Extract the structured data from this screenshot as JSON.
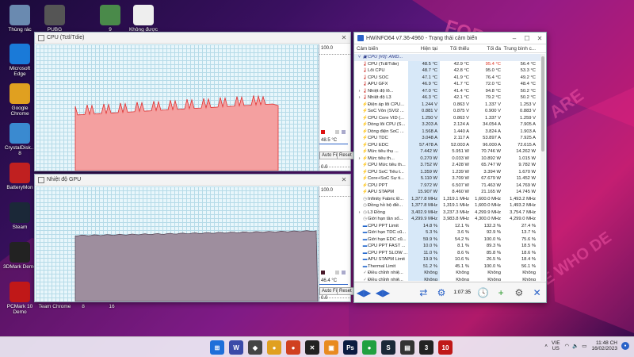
{
  "desktop": {
    "icons": [
      {
        "label": "Thùng rác",
        "icon": "recycle-bin-icon",
        "color": "#6a8ab0"
      },
      {
        "label": "PUBG BATTLEGR...",
        "icon": "pubg-icon",
        "color": "#555"
      },
      {
        "label": "Không được",
        "icon": "file-icon",
        "color": "#eeeeee"
      },
      {
        "label": "9",
        "icon": "image-icon",
        "color": "#4a8a4a"
      },
      {
        "label": "Microsoft Edge",
        "icon": "edge-icon",
        "color": "#1a7ad8"
      },
      {
        "label": "Google Chrome",
        "icon": "chrome-icon",
        "color": "#e0a020"
      },
      {
        "label": "CrystalDisk... 8",
        "icon": "crystaldisk-icon",
        "color": "#3a8ad0"
      },
      {
        "label": "BatteryMon",
        "icon": "battery-icon",
        "color": "#c02020"
      },
      {
        "label": "Steam",
        "icon": "steam-icon",
        "color": "#1b2838"
      },
      {
        "label": "3DMark Demo",
        "icon": "3dmark-icon",
        "color": "#222"
      },
      {
        "label": "PCMark 10 Demo",
        "icon": "pcmark-icon",
        "color": "#c01818"
      },
      {
        "label": "Team Chrome",
        "icon": "chrome-icon",
        "color": "#e0a020"
      },
      {
        "label": "8",
        "icon": "image-icon",
        "color": "#333"
      },
      {
        "label": "16",
        "icon": "image-icon",
        "color": "#333"
      }
    ]
  },
  "cpu_window": {
    "title": "CPU (Tctl/Tdie)",
    "max_label": "100.0",
    "min_label": "0.0",
    "current": "48.5 °C",
    "auto_fit": "Auto Fit",
    "reset": "Reset",
    "fill_color": "#f4a0a0",
    "line_color": "#e03030"
  },
  "gpu_window": {
    "title": "Nhiệt độ GPU",
    "max_label": "100.0",
    "min_label": "0.0",
    "current": "46.4 °C",
    "auto_fit": "Auto Fit",
    "reset": "Reset",
    "fill_color": "#9e8e9e",
    "line_color": "#5a4a5a"
  },
  "hwinfo": {
    "title": "HWiNFO64 v7.36-4960 - Trạng thái cảm biến",
    "columns": {
      "name": "Cảm biến",
      "current": "Hiện tại",
      "min": "Tối thiểu",
      "max": "Tối đa",
      "avg": "Trung bình c..."
    },
    "rows": [
      {
        "type": "group",
        "name": "CPU [#0]: AMD...",
        "icon": "chip-icon",
        "current": "",
        "min": "",
        "max": "",
        "avg": ""
      },
      {
        "name": "CPU (Tctl/Tdie)",
        "icon": "thermometer-icon",
        "ic": "t-red",
        "current": "48.5 °C",
        "min": "42.9 °C",
        "max": "95.4 °C",
        "avg": "56.4 °C",
        "maxred": true
      },
      {
        "name": "Lõi CPU",
        "icon": "thermometer-icon",
        "ic": "t-red",
        "current": "48.7 °C",
        "min": "42.8 °C",
        "max": "95.0 °C",
        "avg": "53.3 °C"
      },
      {
        "name": "CPU SOC",
        "icon": "thermometer-icon",
        "ic": "t-red",
        "current": "47.1 °C",
        "min": "41.9 °C",
        "max": "76.4 °C",
        "avg": "49.2 °C"
      },
      {
        "name": "APU GFX",
        "icon": "thermometer-icon",
        "ic": "t-red",
        "current": "46.9 °C",
        "min": "41.7 °C",
        "max": "72.0 °C",
        "avg": "48.4 °C"
      },
      {
        "name": "Nhiệt độ lõ...",
        "icon": "thermometer-icon",
        "ic": "t-red",
        "current": "47.0 °C",
        "min": "41.4 °C",
        "max": "94.8 °C",
        "avg": "50.2 °C",
        "expand": true
      },
      {
        "name": "Nhiệt độ L3",
        "icon": "thermometer-icon",
        "ic": "t-red",
        "current": "46.3 °C",
        "min": "42.1 °C",
        "max": "79.2 °C",
        "avg": "50.2 °C",
        "expand": true
      },
      {
        "name": "Điện áp lõi CPU...",
        "icon": "voltage-icon",
        "ic": "t-orange",
        "current": "1.244 V",
        "min": "0.863 V",
        "max": "1.337 V",
        "avg": "1.253 V"
      },
      {
        "name": "SoC Vôn (SVI2 ...",
        "icon": "voltage-icon",
        "ic": "t-orange",
        "current": "0.881 V",
        "min": "0.875 V",
        "max": "0.900 V",
        "avg": "0.883 V"
      },
      {
        "name": "CPU Core VID (...",
        "icon": "voltage-icon",
        "ic": "t-orange",
        "current": "1.250 V",
        "min": "0.863 V",
        "max": "1.337 V",
        "avg": "1.259 V"
      },
      {
        "name": "Dòng lõi CPU (S...",
        "icon": "current-icon",
        "ic": "t-orange",
        "current": "3.203 A",
        "min": "2.124 A",
        "max": "34.054 A",
        "avg": "7.905 A"
      },
      {
        "name": "Dòng điện SoC ...",
        "icon": "current-icon",
        "ic": "t-orange",
        "current": "1.568 A",
        "min": "1.440 A",
        "max": "3.824 A",
        "avg": "1.903 A"
      },
      {
        "name": "CPU TDC",
        "icon": "current-icon",
        "ic": "t-orange",
        "current": "3.048 A",
        "min": "2.117 A",
        "max": "53.897 A",
        "avg": "7.925 A"
      },
      {
        "name": "CPU EDC",
        "icon": "current-icon",
        "ic": "t-orange",
        "current": "57.478 A",
        "min": "52.003 A",
        "max": "96.000 A",
        "avg": "72.615 A"
      },
      {
        "name": "Mức tiêu thụ ...",
        "icon": "power-icon",
        "ic": "t-orange",
        "current": "7.442 W",
        "min": "5.951 W",
        "max": "70.746 W",
        "avg": "14.262 W"
      },
      {
        "name": "Mức tiêu th...",
        "icon": "power-icon",
        "ic": "t-orange",
        "current": "0.270 W",
        "min": "0.033 W",
        "max": "10.892 W",
        "avg": "1.015 W",
        "expand": true
      },
      {
        "name": "CPU Mức tiêu th...",
        "icon": "power-icon",
        "ic": "t-orange",
        "current": "3.752 W",
        "min": "2.428 W",
        "max": "65.747 W",
        "avg": "9.782 W"
      },
      {
        "name": "CPU SoC Tiêu t...",
        "icon": "power-icon",
        "ic": "t-orange",
        "current": "1.359 W",
        "min": "1.239 W",
        "max": "3.394 W",
        "avg": "1.670 W"
      },
      {
        "name": "Core+SoC Sự ti...",
        "icon": "power-icon",
        "ic": "t-orange",
        "current": "5.110 W",
        "min": "3.709 W",
        "max": "67.679 W",
        "avg": "11.452 W"
      },
      {
        "name": "CPU PPT",
        "icon": "power-icon",
        "ic": "t-orange",
        "current": "7.972 W",
        "min": "6.507 W",
        "max": "71.463 W",
        "avg": "14.769 W"
      },
      {
        "name": "APU STAPM",
        "icon": "power-icon",
        "ic": "t-orange",
        "current": "15.907 W",
        "min": "8.460 W",
        "max": "21.165 W",
        "avg": "14.745 W"
      },
      {
        "name": "Infinity Fabric Đ...",
        "icon": "clock-icon",
        "ic": "t-gray",
        "current": "1,377.8 MHz",
        "min": "1,319.1 MHz",
        "max": "1,600.0 MHz",
        "avg": "1,493.2 MHz"
      },
      {
        "name": "Đồng hồ bộ điề...",
        "icon": "clock-icon",
        "ic": "t-gray",
        "current": "1,377.8 MHz",
        "min": "1,319.1 MHz",
        "max": "1,600.0 MHz",
        "avg": "1,493.2 MHz"
      },
      {
        "name": "L3 Đồng",
        "icon": "clock-icon",
        "ic": "t-gray",
        "current": "3,402.9 MHz",
        "min": "3,237.3 MHz",
        "max": "4,299.9 MHz",
        "avg": "3,754.7 MHz",
        "expand": true
      },
      {
        "name": "Giới hạn tần số...",
        "icon": "clock-icon",
        "ic": "t-gray",
        "current": "4,299.9 MHz",
        "min": "3,983.8 MHz",
        "max": "4,300.0 MHz",
        "avg": "4,299.0 MHz"
      },
      {
        "name": "CPU PPT Limit",
        "icon": "percent-icon",
        "ic": "t-blue",
        "current": "14.8 %",
        "min": "12.1 %",
        "max": "132.3 %",
        "avg": "27.4 %"
      },
      {
        "name": "Giới hạn TDC cũ...",
        "icon": "percent-icon",
        "ic": "t-blue",
        "current": "5.3 %",
        "min": "3.6 %",
        "max": "92.9 %",
        "avg": "13.7 %"
      },
      {
        "name": "Giới hạn EDC cũ...",
        "icon": "percent-icon",
        "ic": "t-blue",
        "current": "59.9 %",
        "min": "54.2 %",
        "max": "100.0 %",
        "avg": "75.6 %"
      },
      {
        "name": "CPU PPT FAST ...",
        "icon": "percent-icon",
        "ic": "t-blue",
        "current": "10.0 %",
        "min": "8.1 %",
        "max": "89.3 %",
        "avg": "18.5 %"
      },
      {
        "name": "CPU PPT SLOW ...",
        "icon": "percent-icon",
        "ic": "t-blue",
        "current": "11.0 %",
        "min": "8.6 %",
        "max": "85.8 %",
        "avg": "18.6 %"
      },
      {
        "name": "APU STAPM Limit",
        "icon": "percent-icon",
        "ic": "t-blue",
        "current": "19.9 %",
        "min": "10.6 %",
        "max": "26.5 %",
        "avg": "18.4 %"
      },
      {
        "name": "Thermal Limit",
        "icon": "percent-icon",
        "ic": "t-blue",
        "current": "51.2 %",
        "min": "45.1 %",
        "max": "100.0 %",
        "avg": "56.1 %"
      },
      {
        "name": "Điều chỉnh nhiệ...",
        "icon": "check-icon",
        "ic": "t-gray",
        "current": "Không",
        "min": "Không",
        "max": "Không",
        "avg": "Không"
      },
      {
        "name": "Điều chỉnh nhiệ...",
        "icon": "check-icon",
        "ic": "t-gray",
        "current": "Không",
        "min": "Không",
        "max": "Không",
        "avg": "Không"
      }
    ],
    "timer": "1:07:35"
  },
  "taskbar": {
    "lang_line1": "VIE",
    "lang_line2": "US",
    "time": "11:48 CH",
    "date": "16/02/2023",
    "apps": [
      {
        "icon": "windows-start-icon",
        "color": "#1e6fd9",
        "glyph": "⊞"
      },
      {
        "icon": "task-app-icon",
        "color": "#3a4aa8",
        "glyph": "W"
      },
      {
        "icon": "hwinfo-app-icon",
        "color": "#444",
        "glyph": "◆"
      },
      {
        "icon": "chrome-icon",
        "color": "#e0a020",
        "glyph": "●"
      },
      {
        "icon": "chrome-icon",
        "color": "#d04020",
        "glyph": "●"
      },
      {
        "icon": "xbox-icon",
        "color": "#222",
        "glyph": "✕"
      },
      {
        "icon": "gallery-icon",
        "color": "#e88a20",
        "glyph": "▣"
      },
      {
        "icon": "photoshop-icon",
        "color": "#0a1a40",
        "glyph": "Ps"
      },
      {
        "icon": "chrome-icon",
        "color": "#20a040",
        "glyph": "●"
      },
      {
        "icon": "steam-icon",
        "color": "#1b2838",
        "glyph": "S"
      },
      {
        "icon": "monitor-app-icon",
        "color": "#333",
        "glyph": "▤"
      },
      {
        "icon": "3dmark-icon",
        "color": "#222",
        "glyph": "3"
      },
      {
        "icon": "pcmark-icon",
        "color": "#c01818",
        "glyph": "10"
      }
    ]
  }
}
